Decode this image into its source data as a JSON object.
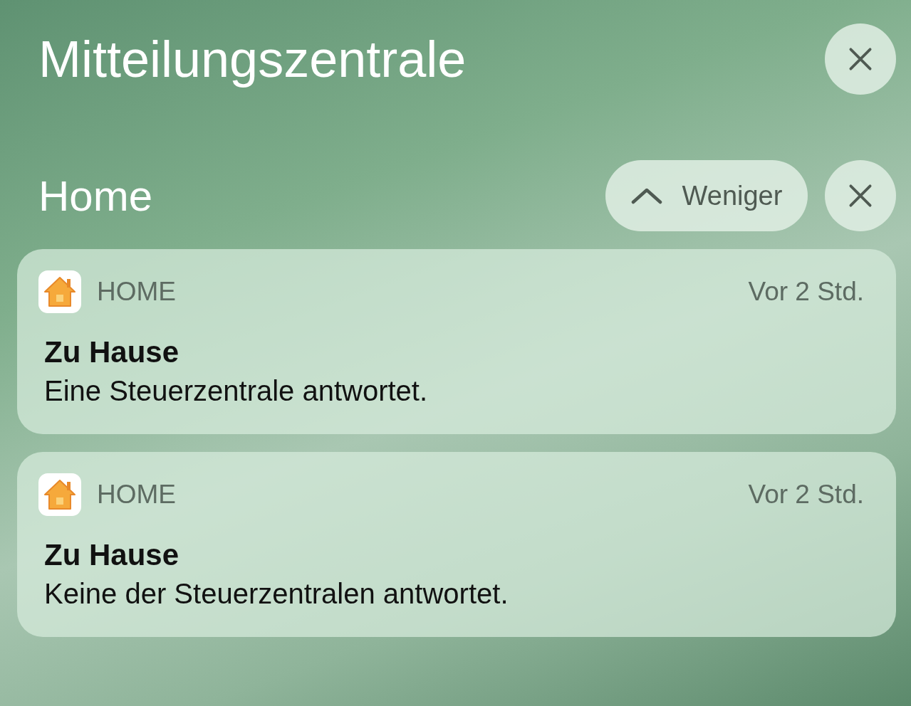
{
  "header": {
    "title": "Mitteilungszentrale"
  },
  "group": {
    "title": "Home",
    "collapse_label": "Weniger"
  },
  "notifications": [
    {
      "app": "HOME",
      "time": "Vor 2 Std.",
      "title": "Zu Hause",
      "body": "Eine Steuerzentrale antwortet."
    },
    {
      "app": "HOME",
      "time": "Vor 2 Std.",
      "title": "Zu Hause",
      "body": "Keine der Steuerzentralen antwortet."
    }
  ]
}
